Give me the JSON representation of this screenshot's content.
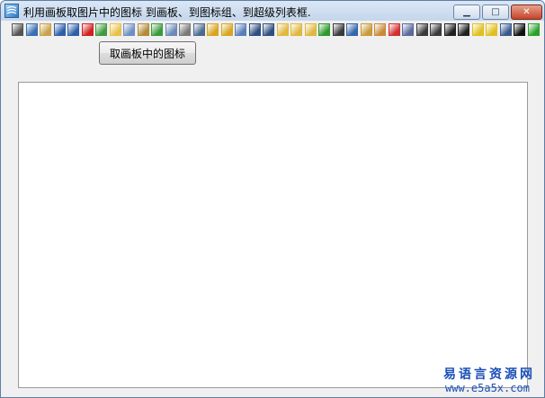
{
  "window": {
    "title": "利用画板取图片中的图标 到画板、到图标组、到超级列表框.",
    "minimize_glyph": "▁",
    "maximize_glyph": "□",
    "close_glyph": "✕"
  },
  "toolbar": {
    "icons": [
      {
        "name": "cut-icon",
        "color": "#555555"
      },
      {
        "name": "copy-icon",
        "color": "#3a6fb0"
      },
      {
        "name": "paste-icon",
        "color": "#c9a24a"
      },
      {
        "name": "undo-icon",
        "color": "#2d5fa8"
      },
      {
        "name": "redo-icon",
        "color": "#2d5fa8"
      },
      {
        "name": "delete-icon",
        "color": "#d02020"
      },
      {
        "name": "new-image-icon",
        "color": "#3f9a3f"
      },
      {
        "name": "open-folder-icon",
        "color": "#e7c24a"
      },
      {
        "name": "properties-icon",
        "color": "#6e8fc2"
      },
      {
        "name": "clipboard-icon",
        "color": "#b38b3a"
      },
      {
        "name": "pointer-icon",
        "color": "#3a9a3a"
      },
      {
        "name": "find-icon",
        "color": "#6b8bb5"
      },
      {
        "name": "print-icon",
        "color": "#7a7a7a"
      },
      {
        "name": "binoculars-icon",
        "color": "#4a6a90"
      },
      {
        "name": "lock-icon",
        "color": "#d9a520"
      },
      {
        "name": "unlock-icon",
        "color": "#d9a520"
      },
      {
        "name": "cube-icon",
        "color": "#5a7fb8"
      },
      {
        "name": "save-icon",
        "color": "#2f4f80"
      },
      {
        "name": "save-all-icon",
        "color": "#2f4f80"
      },
      {
        "name": "folder-add-icon",
        "color": "#e0b840"
      },
      {
        "name": "folder-plus-icon",
        "color": "#e0b840"
      },
      {
        "name": "folder-star-icon",
        "color": "#e0b840"
      },
      {
        "name": "green-box-icon",
        "color": "#2e9a2e"
      },
      {
        "name": "grid-icon",
        "color": "#3a3a3a"
      },
      {
        "name": "text-icon",
        "color": "#3366aa"
      },
      {
        "name": "pencil-icon",
        "color": "#c99a3a"
      },
      {
        "name": "pen-icon",
        "color": "#c98a3a"
      },
      {
        "name": "remove-icon",
        "color": "#d03030"
      },
      {
        "name": "document-icon",
        "color": "#5a6a9a"
      },
      {
        "name": "select-icon",
        "color": "#3a3a3a"
      },
      {
        "name": "marquee-icon",
        "color": "#3a3a3a"
      },
      {
        "name": "frame-icon",
        "color": "#202020"
      },
      {
        "name": "frame-double-icon",
        "color": "#202020"
      },
      {
        "name": "sparkle-icon",
        "color": "#e0c020"
      },
      {
        "name": "sparkle-alt-icon",
        "color": "#e0c020"
      },
      {
        "name": "screen-icon",
        "color": "#3a5a8a"
      },
      {
        "name": "black-square-icon",
        "color": "#101010"
      },
      {
        "name": "color-icon",
        "color": "#2aa02a"
      }
    ]
  },
  "actions": {
    "get_icons_label": "取画板中的图标"
  },
  "watermark": {
    "site_cn": "易语言资源网",
    "site_url": "www.e5a5x.com"
  }
}
